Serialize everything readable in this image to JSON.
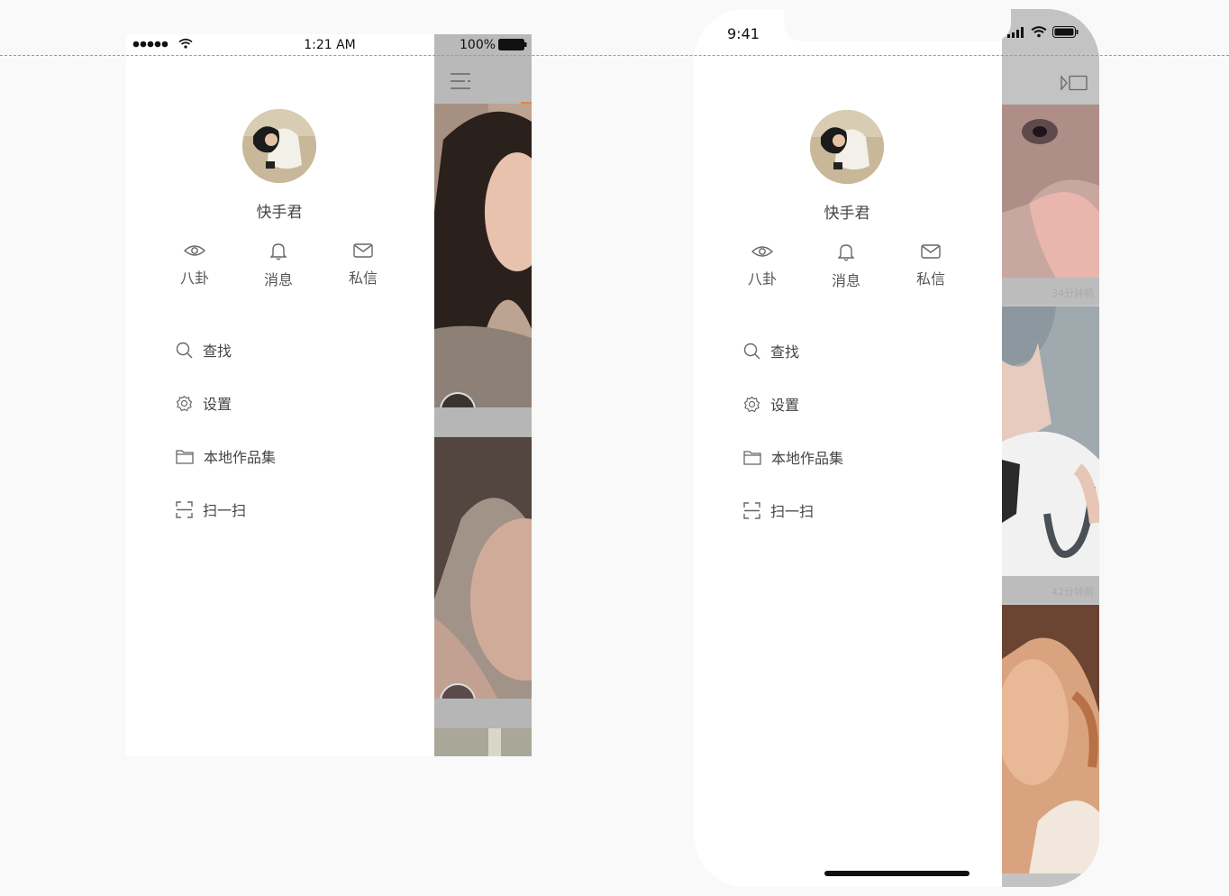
{
  "phone1": {
    "status": {
      "time": "1:21 AM",
      "battery": "100%"
    },
    "user_name": "快手君",
    "quick_actions": [
      {
        "label": "八卦",
        "icon": "eye-icon"
      },
      {
        "label": "消息",
        "icon": "bell-icon"
      },
      {
        "label": "私信",
        "icon": "mail-icon"
      }
    ],
    "menu": [
      {
        "label": "查找",
        "icon": "search-icon"
      },
      {
        "label": "设置",
        "icon": "gear-icon"
      },
      {
        "label": "本地作品集",
        "icon": "folder-icon"
      },
      {
        "label": "扫一扫",
        "icon": "scan-icon"
      }
    ]
  },
  "phone2": {
    "status": {
      "time": "9:41"
    },
    "user_name": "快手君",
    "quick_actions": [
      {
        "label": "八卦",
        "icon": "eye-icon"
      },
      {
        "label": "消息",
        "icon": "bell-icon"
      },
      {
        "label": "私信",
        "icon": "mail-icon"
      }
    ],
    "menu": [
      {
        "label": "查找",
        "icon": "search-icon"
      },
      {
        "label": "设置",
        "icon": "gear-icon"
      },
      {
        "label": "本地作品集",
        "icon": "folder-icon"
      },
      {
        "label": "扫一扫",
        "icon": "scan-icon"
      }
    ],
    "feed_times": [
      "34分钟前",
      "42分钟前"
    ]
  },
  "colors": {
    "page_bg": "#f9f9f9",
    "drawer_bg": "#ffffff",
    "feed_bg": "#b3b3b3",
    "accent": "#e8823a"
  }
}
